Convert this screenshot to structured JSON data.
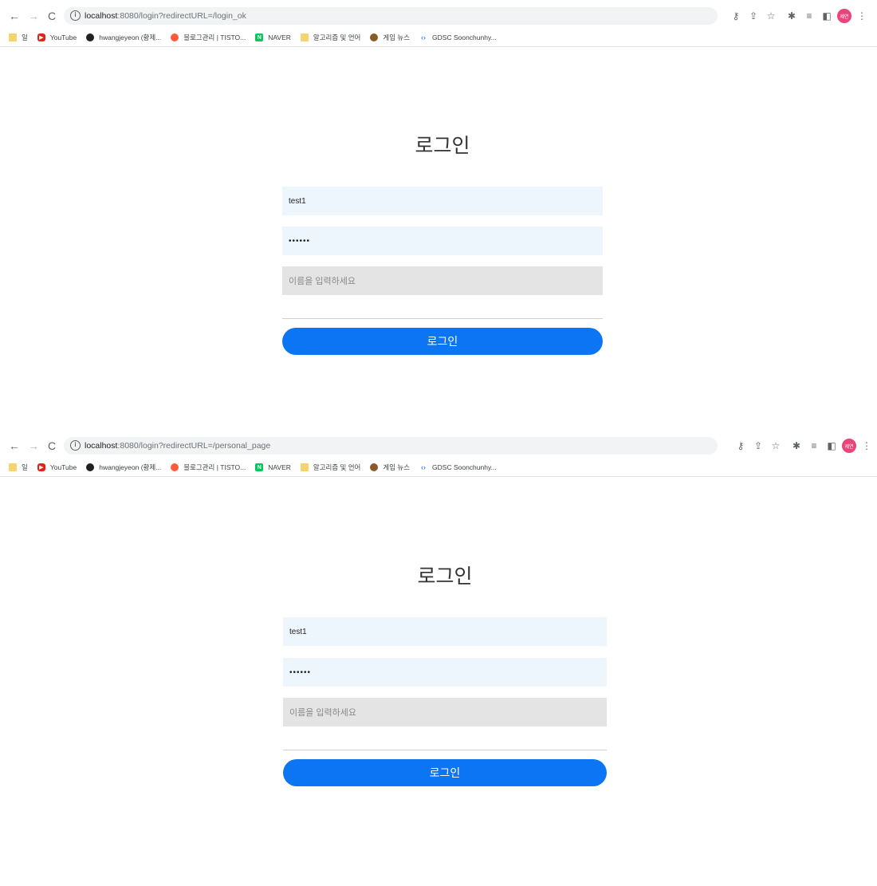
{
  "screens": [
    {
      "url_host": "localhost",
      "url_path": ":8080/login?redirectURL=/login_ok",
      "form": {
        "title": "로그인",
        "username_value": "test1",
        "password_mask": "••••••",
        "name_placeholder": "이름을 입력하세요",
        "submit_label": "로그인"
      }
    },
    {
      "url_host": "localhost",
      "url_path": ":8080/login?redirectURL=/personal_page",
      "form": {
        "title": "로그인",
        "username_value": "test1",
        "password_mask": "••••••",
        "name_placeholder": "이름을 입력하세요",
        "submit_label": "로그인"
      }
    }
  ],
  "bookmarks": [
    {
      "label": "일",
      "icon": "folder-icon"
    },
    {
      "label": "YouTube",
      "icon": "youtube-icon"
    },
    {
      "label": "hwangjeyeon (황제...",
      "icon": "github-icon"
    },
    {
      "label": "블로그관리 | TISTO...",
      "icon": "tistory-icon"
    },
    {
      "label": "NAVER",
      "icon": "naver-icon"
    },
    {
      "label": "알고리즘 및 언어",
      "icon": "folder-icon"
    },
    {
      "label": "게임 뉴스",
      "icon": "game-icon"
    },
    {
      "label": "GDSC Soonchunhy...",
      "icon": "gdsc-icon"
    }
  ],
  "nav": {
    "back": "←",
    "forward": "→",
    "reload": "C"
  },
  "toolbar_icons": [
    "key-icon",
    "share-icon",
    "star-icon",
    "extensions-icon",
    "reading-list-icon",
    "side-panel-icon"
  ],
  "profile": {
    "avatar_text": "제연"
  },
  "colors": {
    "primary": "#0b75f3",
    "field_bg": "#eef6fd",
    "name_field_bg": "#e4e4e4",
    "avatar": "#e8457b"
  }
}
